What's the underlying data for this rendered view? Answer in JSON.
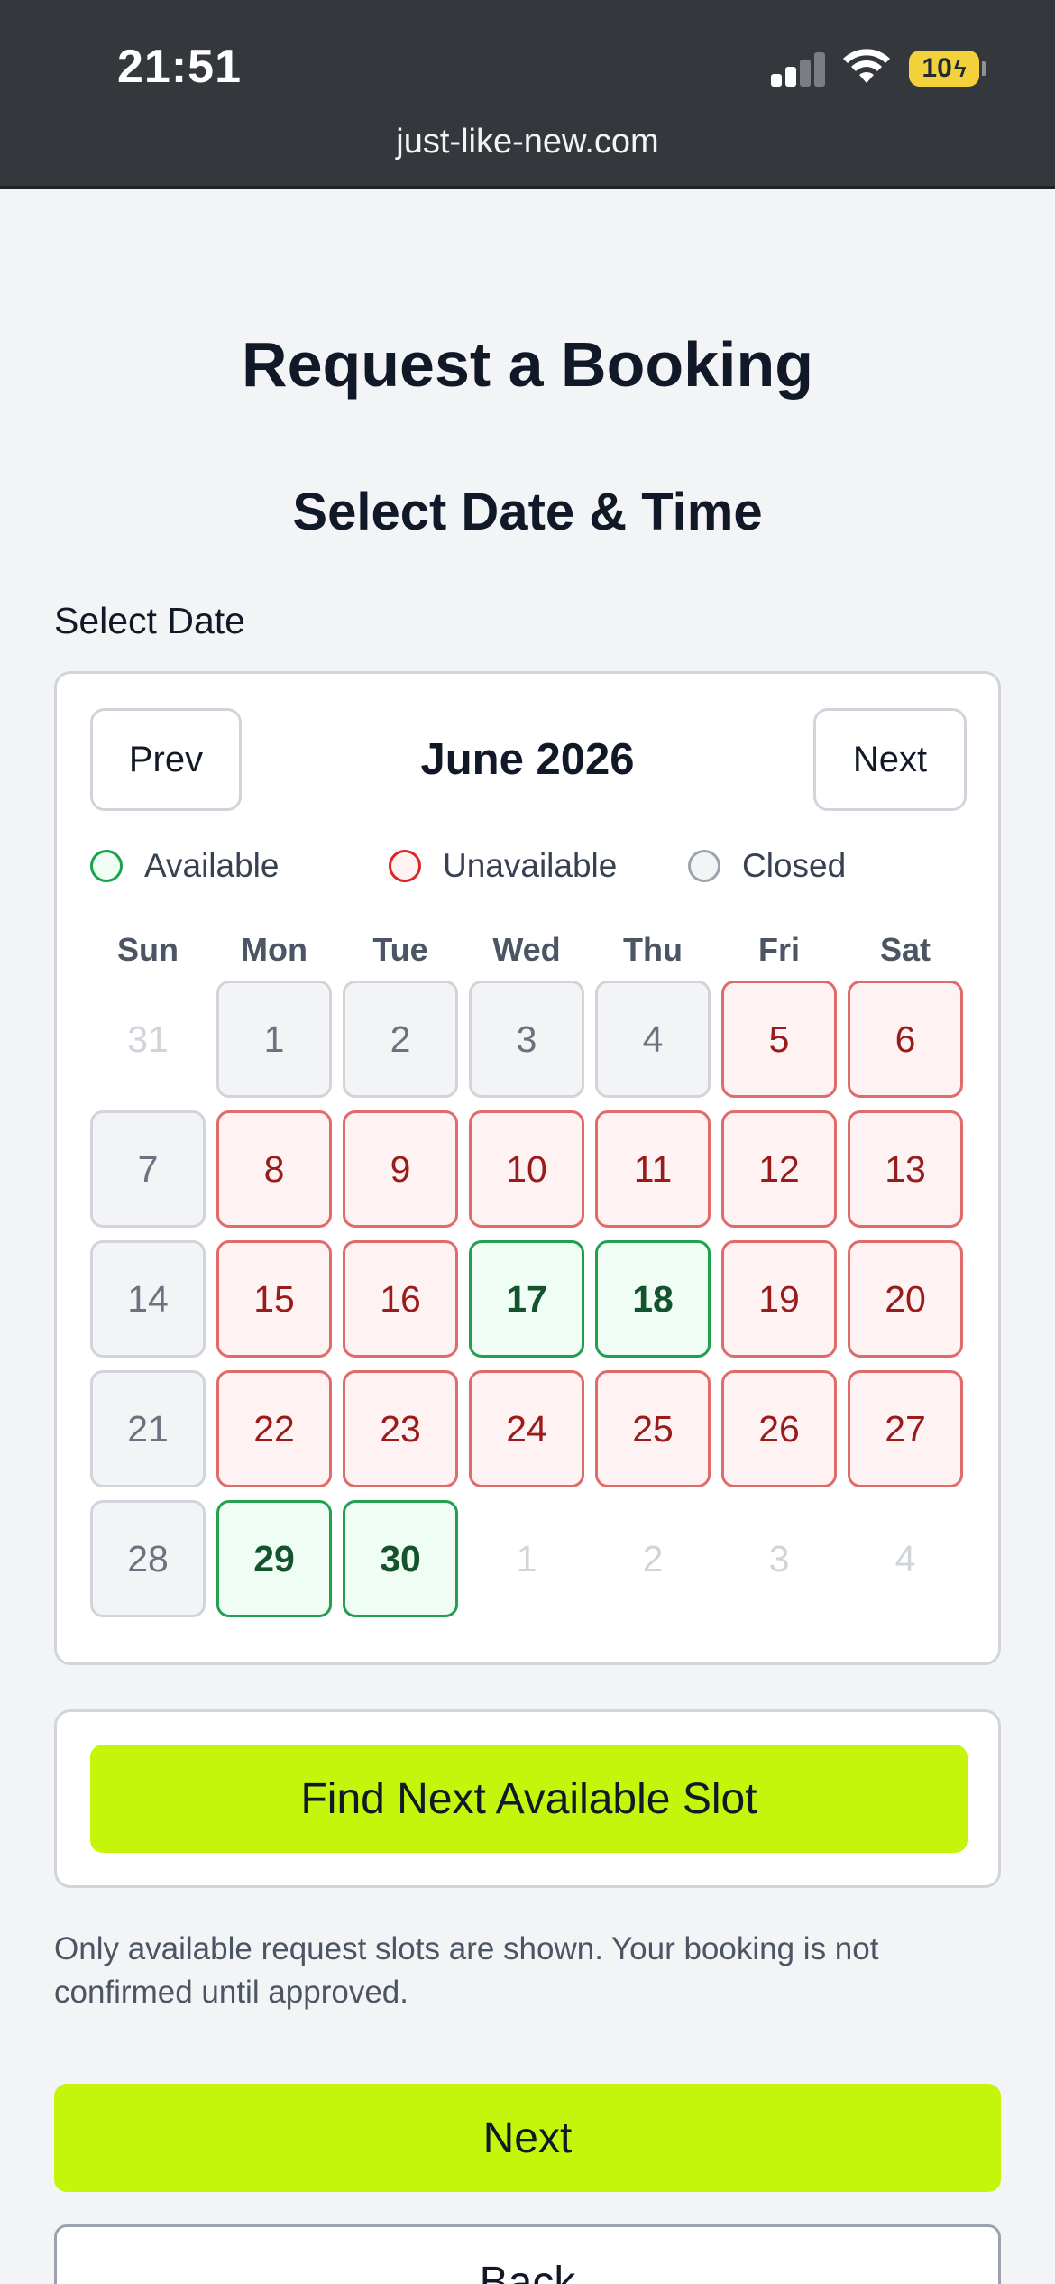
{
  "status_bar": {
    "time": "21:51",
    "battery": "10",
    "signal_icon": "cellular-signal-icon",
    "wifi_icon": "wifi-icon",
    "battery_icon": "battery-charging-icon"
  },
  "browser": {
    "url": "just-like-new.com"
  },
  "page": {
    "title": "Request a Booking",
    "section_title": "Select Date & Time",
    "date_label": "Select Date"
  },
  "calendar": {
    "month_label": "June 2026",
    "prev_label": "Prev",
    "next_label": "Next",
    "legend": [
      {
        "label": "Available",
        "status": "available"
      },
      {
        "label": "Unavailable",
        "status": "unavailable"
      },
      {
        "label": "Closed",
        "status": "closed"
      }
    ],
    "weekdays": [
      "Sun",
      "Mon",
      "Tue",
      "Wed",
      "Thu",
      "Fri",
      "Sat"
    ],
    "weeks": [
      [
        {
          "day": "31",
          "status": "outside"
        },
        {
          "day": "1",
          "status": "closed"
        },
        {
          "day": "2",
          "status": "closed"
        },
        {
          "day": "3",
          "status": "closed"
        },
        {
          "day": "4",
          "status": "closed"
        },
        {
          "day": "5",
          "status": "unavailable"
        },
        {
          "day": "6",
          "status": "unavailable"
        }
      ],
      [
        {
          "day": "7",
          "status": "closed"
        },
        {
          "day": "8",
          "status": "unavailable"
        },
        {
          "day": "9",
          "status": "unavailable"
        },
        {
          "day": "10",
          "status": "unavailable"
        },
        {
          "day": "11",
          "status": "unavailable"
        },
        {
          "day": "12",
          "status": "unavailable"
        },
        {
          "day": "13",
          "status": "unavailable"
        }
      ],
      [
        {
          "day": "14",
          "status": "closed"
        },
        {
          "day": "15",
          "status": "unavailable"
        },
        {
          "day": "16",
          "status": "unavailable"
        },
        {
          "day": "17",
          "status": "available"
        },
        {
          "day": "18",
          "status": "available"
        },
        {
          "day": "19",
          "status": "unavailable"
        },
        {
          "day": "20",
          "status": "unavailable"
        }
      ],
      [
        {
          "day": "21",
          "status": "closed"
        },
        {
          "day": "22",
          "status": "unavailable"
        },
        {
          "day": "23",
          "status": "unavailable"
        },
        {
          "day": "24",
          "status": "unavailable"
        },
        {
          "day": "25",
          "status": "unavailable"
        },
        {
          "day": "26",
          "status": "unavailable"
        },
        {
          "day": "27",
          "status": "unavailable"
        }
      ],
      [
        {
          "day": "28",
          "status": "closed"
        },
        {
          "day": "29",
          "status": "available"
        },
        {
          "day": "30",
          "status": "available"
        },
        {
          "day": "1",
          "status": "outside"
        },
        {
          "day": "2",
          "status": "outside"
        },
        {
          "day": "3",
          "status": "outside"
        },
        {
          "day": "4",
          "status": "outside"
        }
      ]
    ]
  },
  "find_slot": {
    "label": "Find Next Available Slot"
  },
  "note": "Only available request slots are shown. Your booking is not confirmed until approved.",
  "actions": {
    "next_label": "Next",
    "back_label": "Back"
  },
  "colors": {
    "accent": "#c5f50b",
    "available": "#22a04f",
    "unavailable": "#e06b6b",
    "closed": "#d1d5db",
    "chrome": "#34373c"
  }
}
